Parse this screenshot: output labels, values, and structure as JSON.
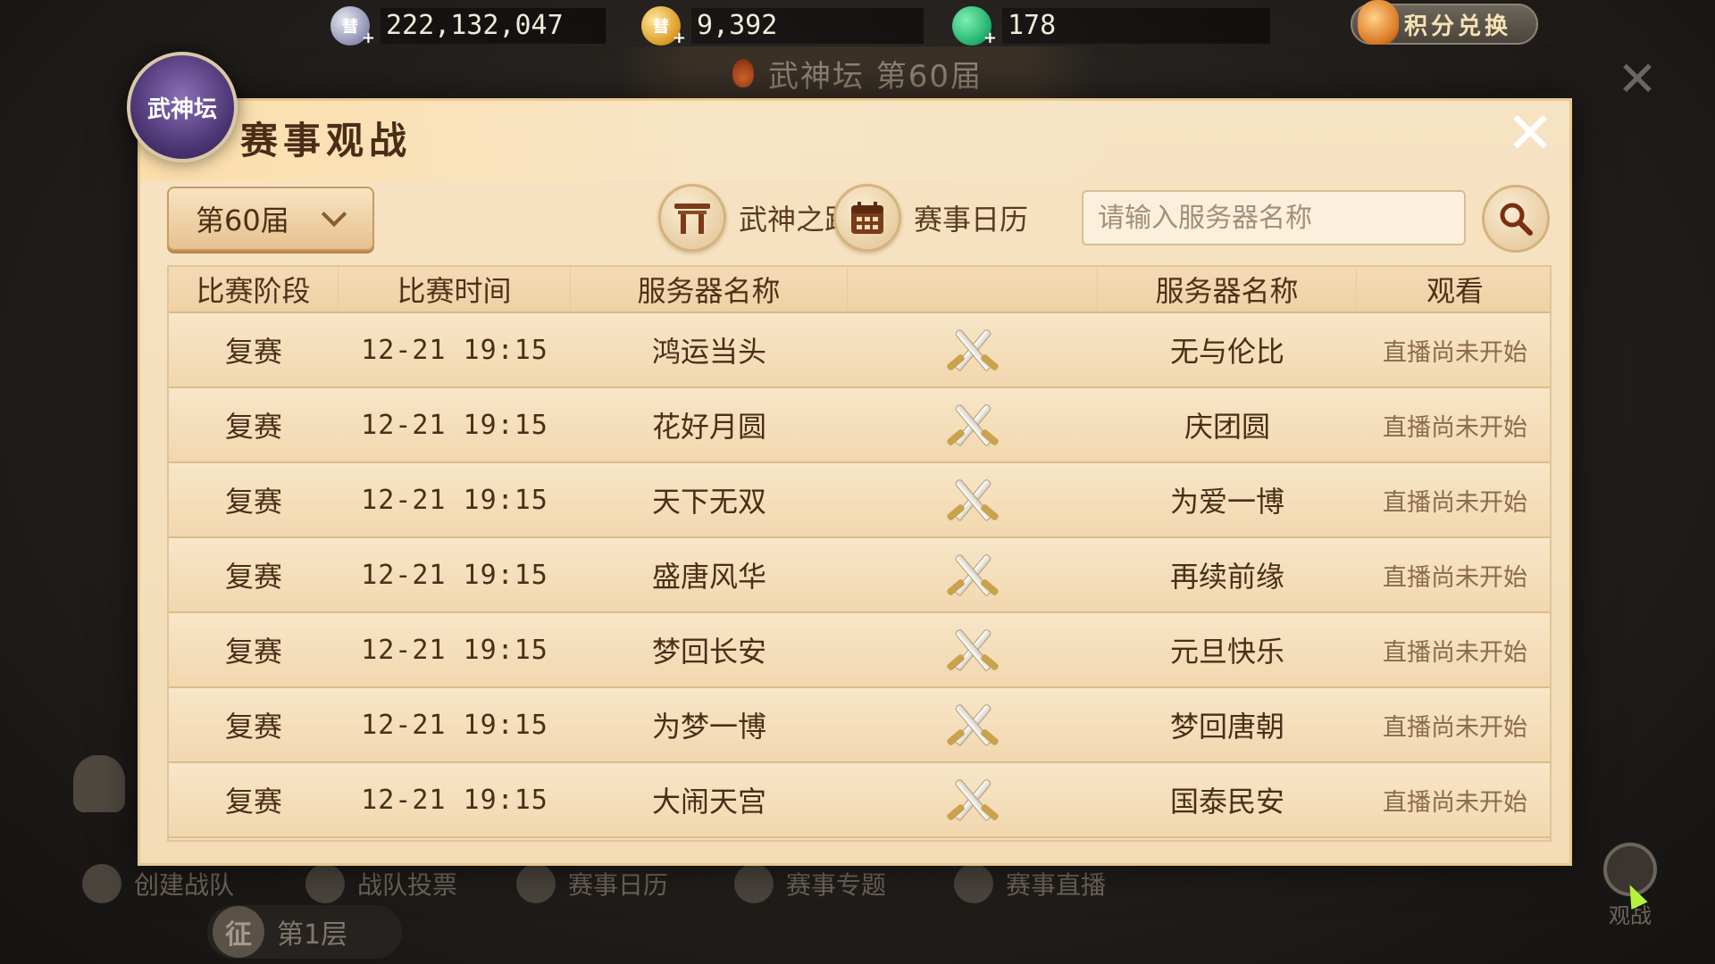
{
  "resources": [
    {
      "icon": "silver-coin-icon",
      "glyph": "彗",
      "value": "222,132,047"
    },
    {
      "icon": "gold-coin-icon",
      "glyph": "彗",
      "value": "9,392"
    },
    {
      "icon": "jade-icon",
      "glyph": "",
      "value": "178"
    }
  ],
  "exchange": {
    "label": "积分兑换"
  },
  "event": {
    "title": "武神坛 第60届"
  },
  "emblem": {
    "label": "武神坛"
  },
  "dialog": {
    "title": "赛事观战",
    "season": "第60届",
    "road_label": "武神之路",
    "calendar_label": "赛事日历",
    "search_placeholder": "请输入服务器名称"
  },
  "table": {
    "headers": [
      "比赛阶段",
      "比赛时间",
      "服务器名称",
      "",
      "服务器名称",
      "观看"
    ],
    "rows": [
      {
        "stage": "复赛",
        "time": "12-21  19:15",
        "server_a": "鸿运当头",
        "server_b": "无与伦比",
        "watch": "直播尚未开始"
      },
      {
        "stage": "复赛",
        "time": "12-21  19:15",
        "server_a": "花好月圆",
        "server_b": "庆团圆",
        "watch": "直播尚未开始"
      },
      {
        "stage": "复赛",
        "time": "12-21  19:15",
        "server_a": "天下无双",
        "server_b": "为爱一博",
        "watch": "直播尚未开始"
      },
      {
        "stage": "复赛",
        "time": "12-21  19:15",
        "server_a": "盛唐风华",
        "server_b": "再续前缘",
        "watch": "直播尚未开始"
      },
      {
        "stage": "复赛",
        "time": "12-21  19:15",
        "server_a": "梦回长安",
        "server_b": "元旦快乐",
        "watch": "直播尚未开始"
      },
      {
        "stage": "复赛",
        "time": "12-21  19:15",
        "server_a": "为梦一博",
        "server_b": "梦回唐朝",
        "watch": "直播尚未开始"
      },
      {
        "stage": "复赛",
        "time": "12-21  19:15",
        "server_a": "大闹天宫",
        "server_b": "国泰民安",
        "watch": "直播尚未开始"
      }
    ]
  },
  "bottom": {
    "create_team": "创建战队",
    "team_vote": "战队投票",
    "calendar": "赛事日历",
    "topics": "赛事专题",
    "live": "赛事直播",
    "tower_glyph": "征",
    "tower_floor": "第1层",
    "spectate": "观战"
  },
  "colors": {
    "panel": "#f6e3c3",
    "accent_border": "#e9c98e",
    "text_dark": "#4a2e18",
    "muted": "#8b6b4d"
  }
}
